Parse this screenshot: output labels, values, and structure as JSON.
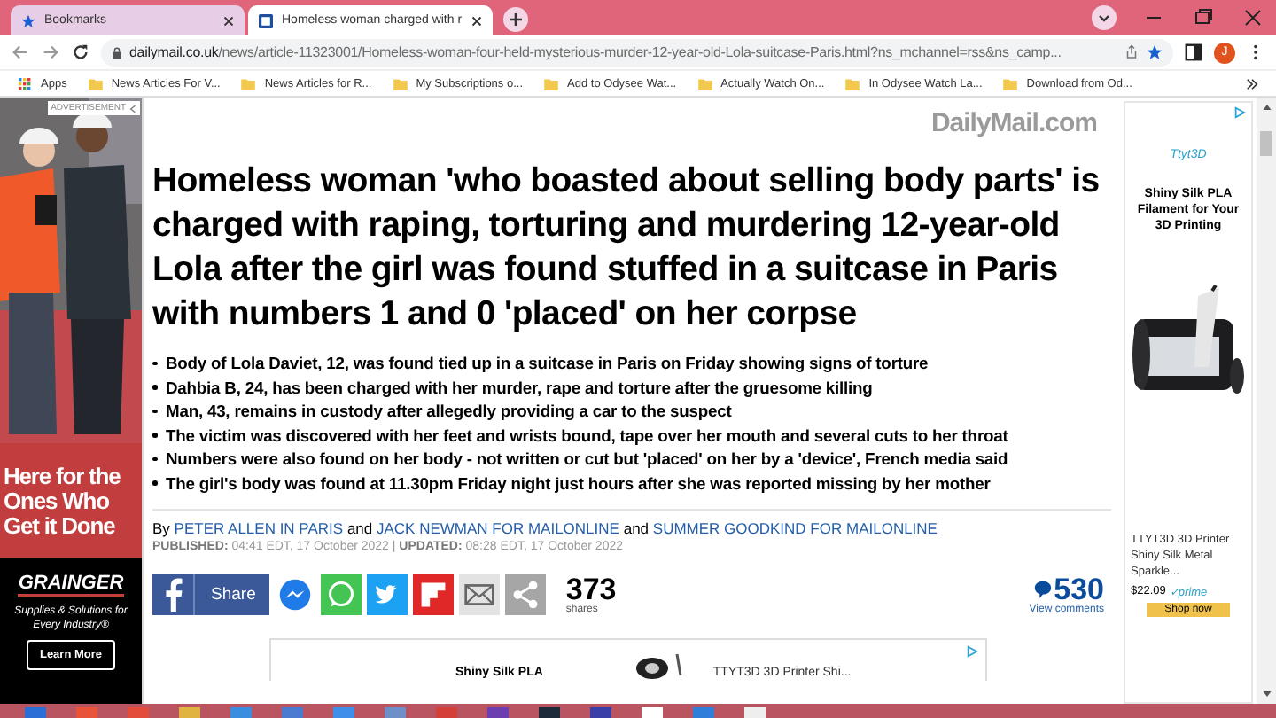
{
  "browser": {
    "tabs": [
      {
        "title": "Bookmarks",
        "kind": "star",
        "selected": false
      },
      {
        "title": "Homeless woman charged with r",
        "kind": "site",
        "selected": true
      }
    ],
    "url_domain": "dailymail.co.uk",
    "url_path": "/news/article-11323001/Homeless-woman-four-held-mysterious-murder-12-year-old-Lola-suitcase-Paris.html?ns_mchannel=rss&ns_camp...",
    "profile_initial": "J",
    "bookmarks": [
      "Apps",
      "News Articles For V...",
      "News Articles for R...",
      "My Subscriptions o...",
      "Add to Odysee Wat...",
      "Actually Watch On...",
      "In Odysee Watch La...",
      "Download from Od..."
    ]
  },
  "left_ad": {
    "label": "ADVERTISEMENT",
    "headline": "Here for the Ones Who Get it Done",
    "brand": "GRAINGER",
    "tagline": "Supplies & Solutions for Every Industry®",
    "button": "Learn More"
  },
  "article": {
    "logo": "DailyMail.com",
    "headline": "Homeless woman 'who boasted about selling body parts' is charged with raping, torturing and murdering 12-year-old Lola after the girl was found stuffed in a suitcase in Paris with numbers 1 and 0 'placed' on her corpse",
    "bullets": [
      "Body of Lola Daviet, 12, was found tied up in a suitcase in Paris on Friday showing signs of torture",
      "Dahbia B, 24, has been charged with her murder, rape and torture after the gruesome killing",
      "Man, 43, remains in custody after allegedly providing a car to the suspect",
      "The victim was discovered with her feet and wrists bound, tape over her mouth and several cuts to her throat",
      "Numbers were also found on her body - not written or cut but 'placed' on her by a 'device', French media said",
      "The girl's body was found at 11.30pm Friday night just hours after she was reported missing by her mother"
    ],
    "byline": [
      {
        "kind": "text",
        "text": "By"
      },
      {
        "kind": "link",
        "text": "PETER ALLEN IN PARIS"
      },
      {
        "kind": "text",
        "text": "and"
      },
      {
        "kind": "link",
        "text": "JACK NEWMAN FOR MAILONLINE"
      },
      {
        "kind": "text",
        "text": "and"
      },
      {
        "kind": "link",
        "text": "SUMMER GOODKIND FOR MAILONLINE"
      }
    ],
    "dates": "**PUBLISHED:** 04:41 EDT, 17 October 2022 | **UPDATED:** 08:28 EDT, 17 October 2022",
    "share_button": "Share",
    "share_count": "373",
    "share_label": "shares",
    "comment_count": "530",
    "comment_label": "View comments"
  },
  "bottom_ad": {
    "title": "Shiny Silk PLA",
    "product": "TTYT3D 3D Printer Shi..."
  },
  "right_ad": {
    "brand": "Ttyt3D",
    "title": "Shiny Silk PLA Filament for Your 3D Printing",
    "product": "TTYT3D 3D Printer Shiny Silk Metal Sparkle...",
    "price": "$22.09",
    "badge": "✓prime",
    "button": "Shop now"
  }
}
